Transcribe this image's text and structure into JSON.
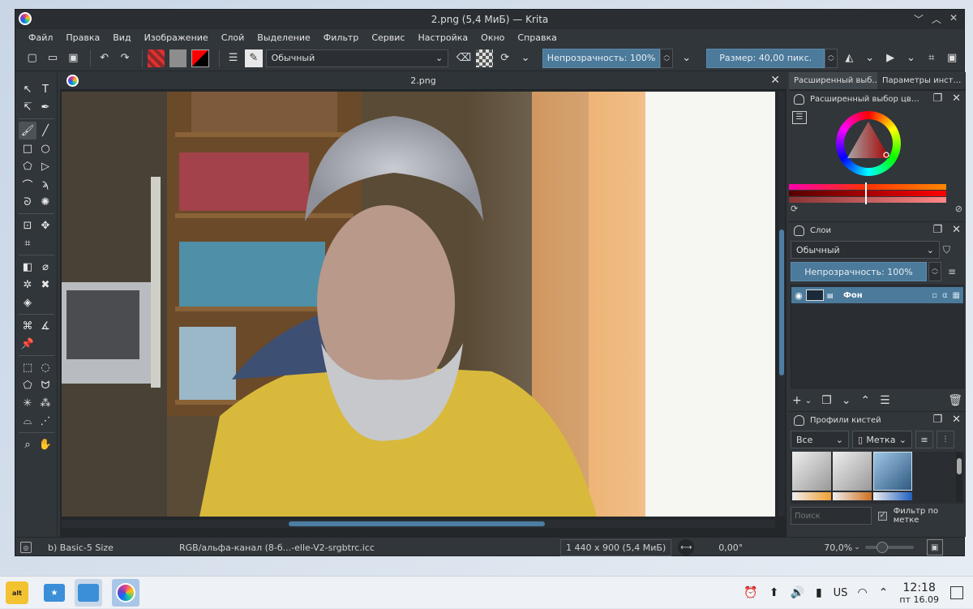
{
  "window": {
    "title": "2.png (5,4 МиБ) — Krita",
    "controls": [
      "﹀",
      "︿",
      "✕"
    ]
  },
  "menu": [
    "Файл",
    "Правка",
    "Вид",
    "Изображение",
    "Слой",
    "Выделение",
    "Фильтр",
    "Сервис",
    "Настройка",
    "Окно",
    "Справка"
  ],
  "toolbar": {
    "blend_mode": "Обычный",
    "opacity_label": "Непрозрачность: 100%",
    "size_label": "Размер: 40,00 пикс."
  },
  "document": {
    "tab_title": "2.png"
  },
  "dock": {
    "tabs": [
      "Расширенный выб…",
      "Параметры инст…"
    ],
    "color_panel_title": "Расширенный выбор цв…",
    "layers_title": "Слои",
    "layers_blend": "Обычный",
    "layers_opacity": "Непрозрачность:  100%",
    "layer_name": "Фон",
    "brushes_title": "Профили кистей",
    "brush_filter": "Все",
    "brush_tag": "Метка",
    "search_placeholder": "Поиск",
    "filter_by_tag": "Фильтр по метке"
  },
  "status": {
    "brush": "b) Basic-5 Size",
    "color_profile": "RGB/альфа-канал (8-б...-elle-V2-srgbtrc.icc",
    "dimensions": "1 440 x 900 (5,4 МиБ)",
    "rotation": "0,00°",
    "zoom": "70,0%"
  },
  "taskbar": {
    "lang": "US",
    "time": "12:18",
    "date": "пт 16.09"
  },
  "colors": {
    "accent": "#4b7a9b",
    "bg": "#31363b"
  }
}
